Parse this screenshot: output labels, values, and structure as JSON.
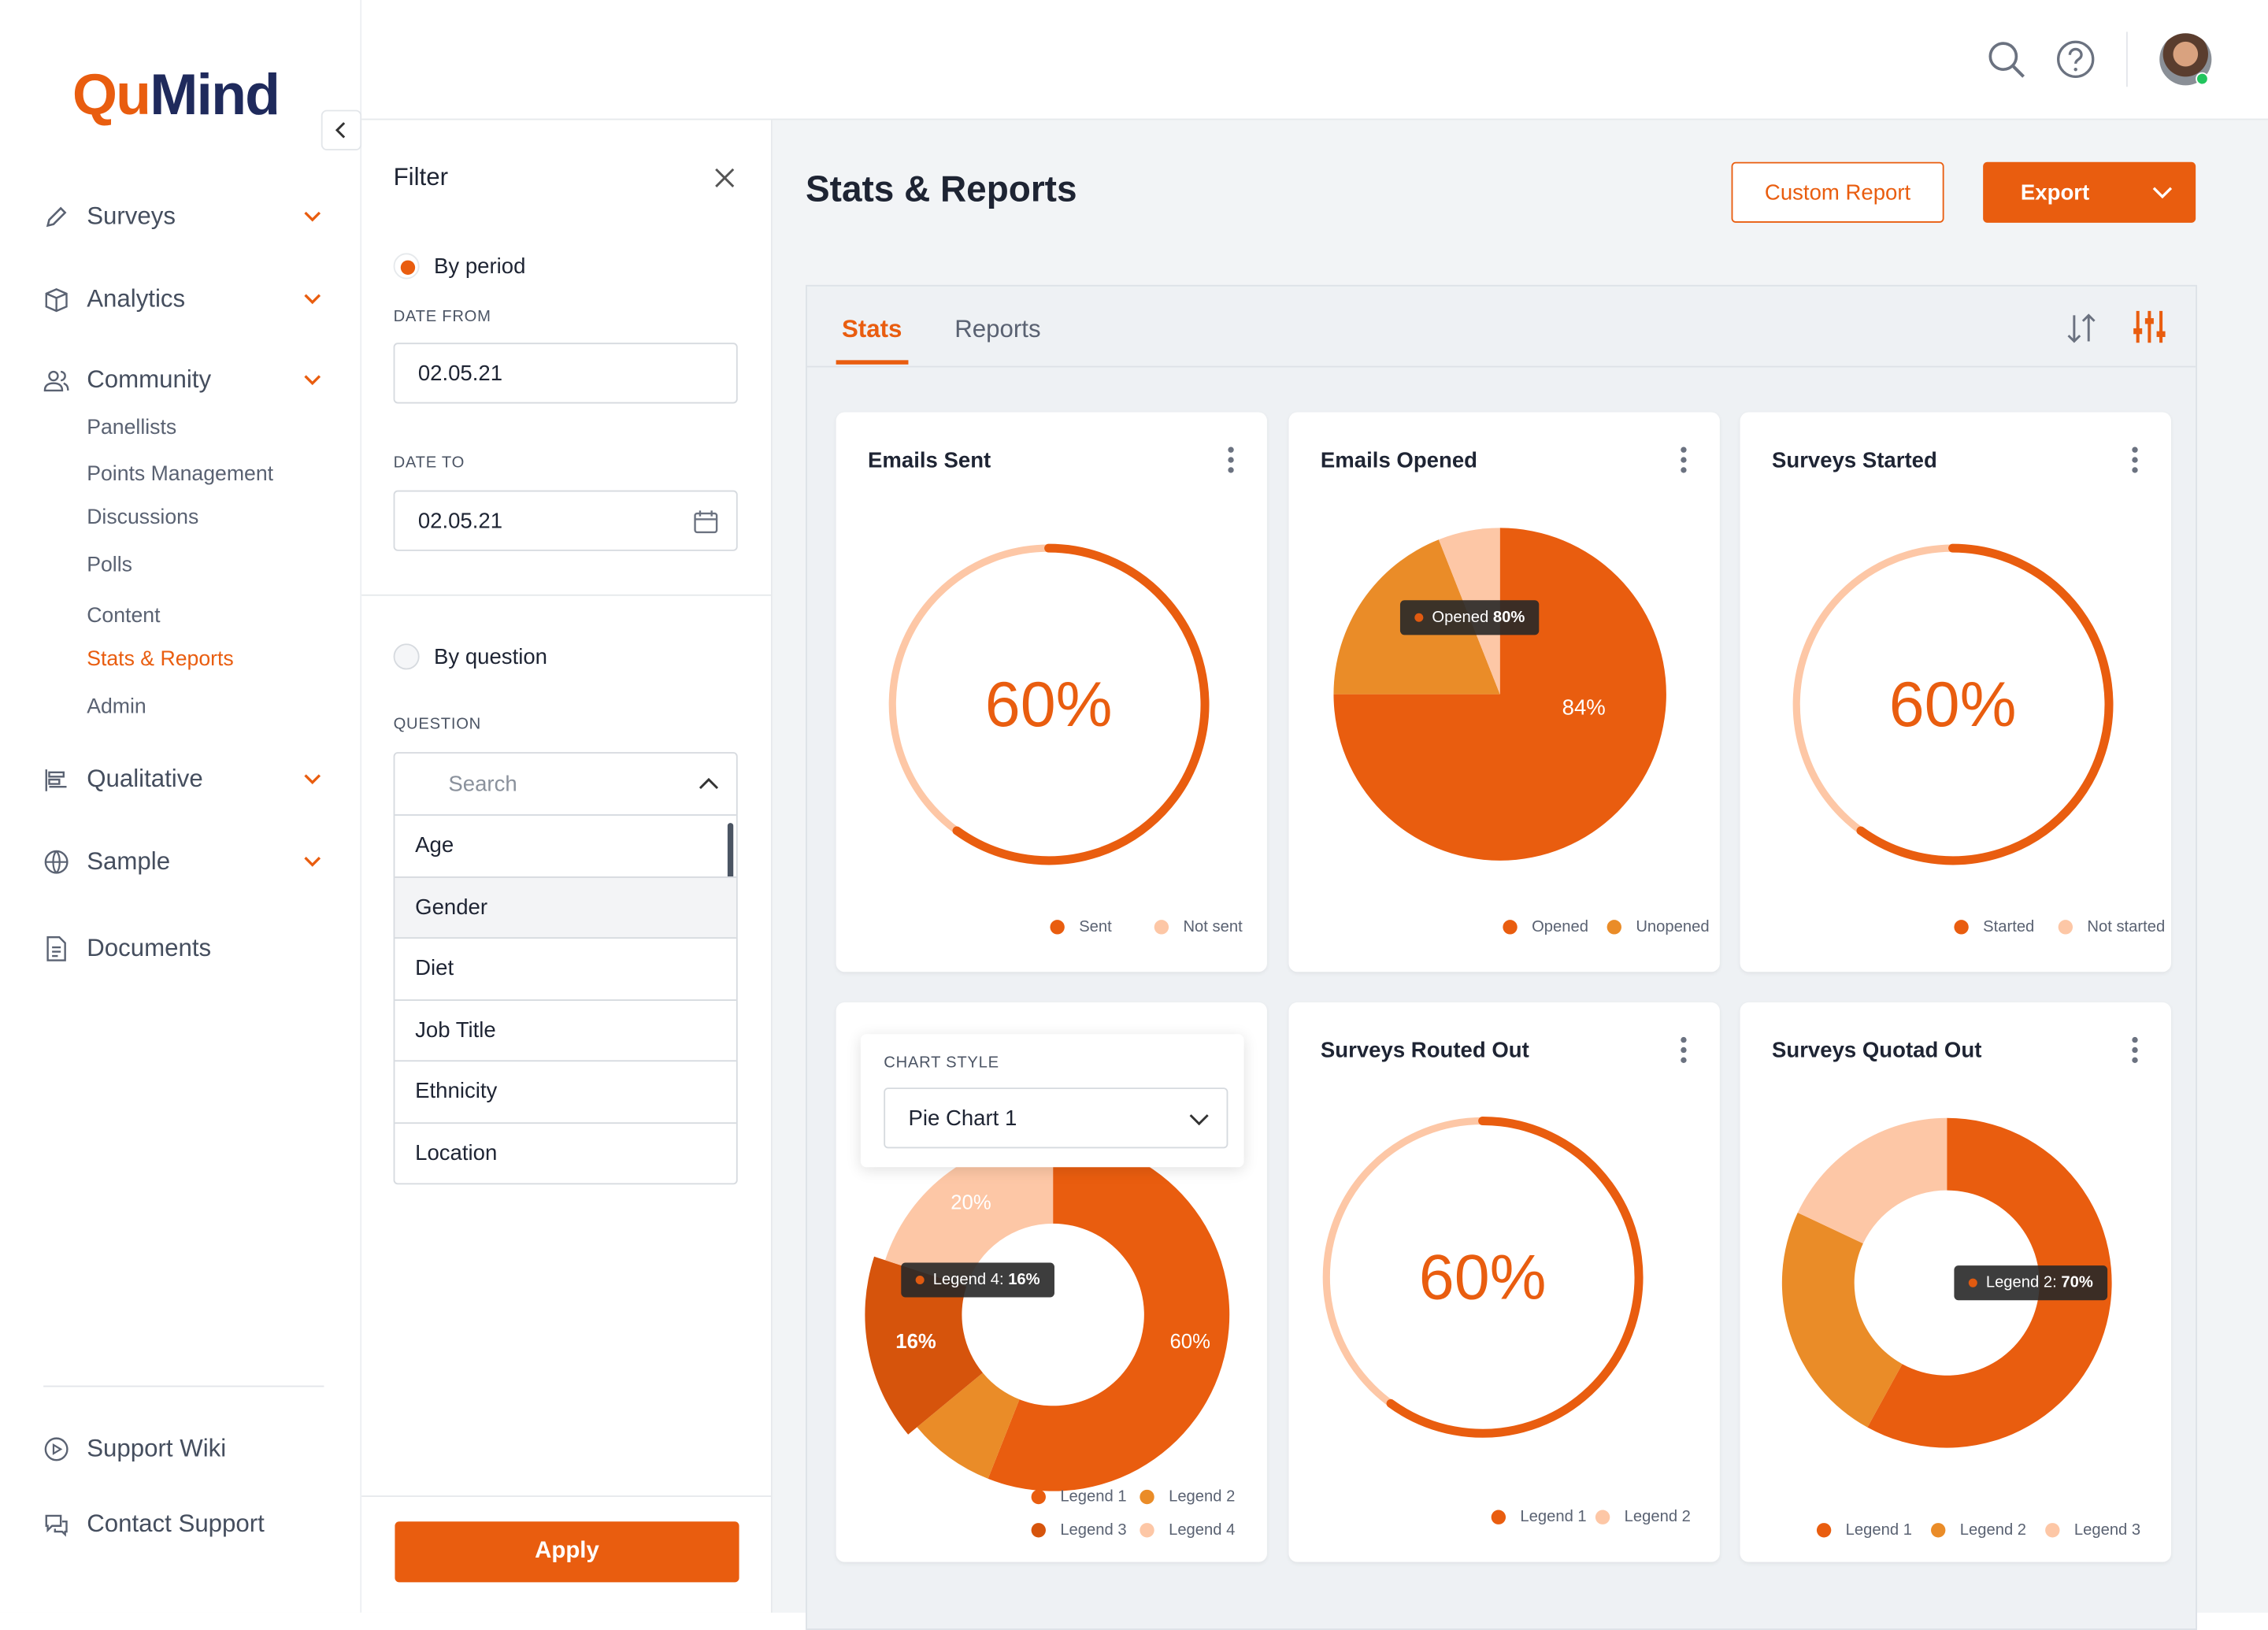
{
  "brand": {
    "logo_part1": "Qu",
    "logo_part2": "Mind",
    "accent": "#e95d0f"
  },
  "sidebar": {
    "items": [
      {
        "label": "Surveys",
        "icon": "pencil-icon"
      },
      {
        "label": "Analytics",
        "icon": "box-icon"
      },
      {
        "label": "Community",
        "icon": "users-icon"
      },
      {
        "label": "Qualitative",
        "icon": "bars-icon"
      },
      {
        "label": "Sample",
        "icon": "globe-icon"
      },
      {
        "label": "Documents",
        "icon": "document-icon"
      }
    ],
    "community_sub": [
      "Panellists",
      "Points Management",
      "Discussions",
      "Polls",
      "Content",
      "Stats & Reports",
      "Admin"
    ],
    "active_sub": "Stats & Reports",
    "footer": [
      {
        "label": "Support Wiki",
        "icon": "play-circle-icon"
      },
      {
        "label": "Contact Support",
        "icon": "chat-icon"
      }
    ]
  },
  "filter": {
    "title": "Filter",
    "by_period": "By period",
    "date_from_label": "DATE FROM",
    "date_from": "02.05.21",
    "date_to_label": "DATE TO",
    "date_to": "02.05.21",
    "by_question": "By question",
    "question_label": "QUESTION",
    "search_placeholder": "Search",
    "questions": [
      "Age",
      "Gender",
      "Diet",
      "Job Title",
      "Ethnicity",
      "Location"
    ],
    "highlighted": "Gender",
    "apply": "Apply"
  },
  "main": {
    "title": "Stats & Reports",
    "custom_report": "Custom Report",
    "export": "Export",
    "tabs": [
      "Stats",
      "Reports"
    ],
    "active_tab": "Stats"
  },
  "chart_style": {
    "label": "CHART STYLE",
    "value": "Pie Chart 1"
  },
  "chart_data": [
    {
      "type": "gauge",
      "title": "Emails Sent",
      "value": 60,
      "label": "60%",
      "legend": [
        "Sent",
        "Not sent"
      ],
      "colors": [
        "#e95d0f",
        "#fdc7a6"
      ]
    },
    {
      "type": "pie",
      "title": "Emails Opened",
      "slices": [
        {
          "name": "Opened",
          "value": 75
        },
        {
          "name": "Unopened",
          "value": 19
        },
        {
          "value": 6
        }
      ],
      "data_label": "84%",
      "tooltip": {
        "name": "Opened",
        "value": "80%"
      },
      "legend": [
        "Opened",
        "Unopened"
      ],
      "colors": [
        "#e95d0f",
        "#ea8c28",
        "#fdc7a6"
      ]
    },
    {
      "type": "gauge",
      "title": "Surveys Started",
      "value": 60,
      "label": "60%",
      "legend": [
        "Started",
        "Not started"
      ],
      "colors": [
        "#e95d0f",
        "#fdc7a6"
      ]
    },
    {
      "type": "donut",
      "title": "",
      "slices": [
        {
          "name": "Legend 1",
          "value": 56,
          "label": "60%"
        },
        {
          "name": "Legend 2",
          "value": 8
        },
        {
          "name": "Legend 3",
          "value": 16,
          "label": "16%",
          "exploded": true
        },
        {
          "name": "Legend 4",
          "value": 20,
          "label": "20%"
        }
      ],
      "tooltip": {
        "name": "Legend 4:",
        "value": "16%"
      },
      "legend": [
        "Legend 1",
        "Legend 2",
        "Legend 3",
        "Legend 4"
      ],
      "colors": [
        "#e95d0f",
        "#ea8c28",
        "#d6540c",
        "#fdc7a6"
      ]
    },
    {
      "type": "gauge",
      "title": "Surveys Routed Out",
      "value": 60,
      "label": "60%",
      "legend": [
        "Legend 1",
        "Legend 2"
      ],
      "colors": [
        "#e95d0f",
        "#fdc7a6"
      ]
    },
    {
      "type": "donut",
      "title": "Surveys Quotad Out",
      "slices": [
        {
          "name": "Legend 1",
          "value": 58
        },
        {
          "name": "Legend 2",
          "value": 24
        },
        {
          "name": "Legend 3",
          "value": 18
        }
      ],
      "tooltip": {
        "name": "Legend 2:",
        "value": "70%"
      },
      "legend": [
        "Legend 1",
        "Legend 2",
        "Legend 3"
      ],
      "colors": [
        "#e95d0f",
        "#ea8c28",
        "#fdc7a6"
      ]
    }
  ]
}
